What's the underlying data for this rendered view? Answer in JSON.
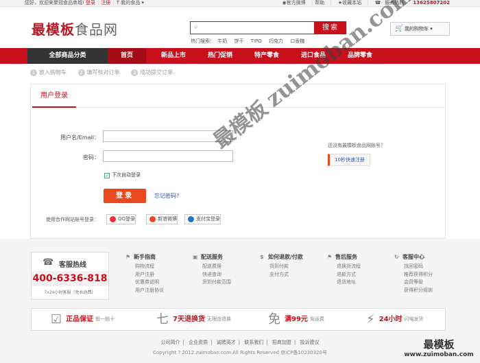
{
  "topbar": {
    "welcome": "您好，欢迎来聚冠食品商城!",
    "login": "登录",
    "register": "注册",
    "my_food": "我的食品",
    "official_weibo": "官方微博",
    "help": "帮助",
    "favorite": "收藏本站",
    "hotline_label": "服务热线：",
    "hotline": "13625807202"
  },
  "header": {
    "logo_main": "最模板",
    "logo_sub": "食品网",
    "search_placeholder": "",
    "search_button": "搜索",
    "hot_label": "热门搜索：",
    "hot_words": [
      "牛奶",
      "饼干",
      "TIPO",
      "巧克力",
      "口香糖"
    ],
    "cart": "我的购物车"
  },
  "nav": {
    "all_categories": "全部商品分类",
    "items": [
      "首页",
      "新品上市",
      "热门促销",
      "特产零食",
      "进口食品",
      "品牌零食"
    ]
  },
  "steps": [
    {
      "num": "1",
      "label": "放入购物车"
    },
    {
      "num": "2",
      "label": "填写核对订单"
    },
    {
      "num": "3",
      "label": "成功提交订单"
    }
  ],
  "login": {
    "title": "用户登录",
    "username_label": "用户名/Email：",
    "password_label": "密码：",
    "username_value": "",
    "password_value": "",
    "auto_login": "下次自动登录",
    "login_button": "登录",
    "forgot": "忘记密码?",
    "partner_label": "使用合作网站账号登录：",
    "partners": [
      "QQ登录",
      "新浪微博",
      "支付宝登录"
    ],
    "no_account": "还没有最模板食品网账号？",
    "quick_register": "10秒快速注册"
  },
  "footer": {
    "hotline_title": "客服热线",
    "hotline_number": "400-6336-818",
    "hotline_note": "7x24小时客服（免长途费）",
    "columns": [
      {
        "title": "新手指南",
        "icon": "flag-icon",
        "links": [
          "购物流程",
          "用户注册",
          "优惠券说明",
          "用户注册协议"
        ]
      },
      {
        "title": "配送服务",
        "icon": "truck-icon",
        "links": [
          "配送费用",
          "快递查询",
          "货到付款范围"
        ]
      },
      {
        "title": "如何退款/付款",
        "icon": "money-icon",
        "links": [
          "货到付款",
          "支付方式"
        ]
      },
      {
        "title": "售后服务",
        "icon": "flag-icon",
        "links": [
          "退换货流程",
          "退款方式",
          "退货地址"
        ]
      },
      {
        "title": "客服中心",
        "icon": "refresh-icon",
        "links": [
          "找回密码",
          "推荐获得积分",
          "会员等级",
          "获得积分规则"
        ]
      }
    ],
    "promos": [
      {
        "icon": "check-icon",
        "glyph": "☑",
        "title": "正品保证",
        "desc": "假一赔十"
      },
      {
        "icon": "seven-icon",
        "glyph": "七",
        "title": "7天退换货",
        "desc": "无理由退换"
      },
      {
        "icon": "free-icon",
        "glyph": "免",
        "title": "满99元",
        "desc": "免运费"
      },
      {
        "icon": "lightning-icon",
        "glyph": "⚡",
        "title": "24小时",
        "desc": "闪电发货"
      }
    ],
    "links": [
      "公司简介",
      "企业资质",
      "诚聘英才",
      "联系我们",
      "招商加盟",
      "投诉建议"
    ],
    "copyright": "Copyright ? 2012 zuimoban.com All Rights Reserved 京ICP备10230320号"
  },
  "watermark": {
    "zh": "最模板",
    "en": "zuimoban.com",
    "corner_zh": "最模板",
    "corner_en": "www.zuimoban.com"
  }
}
